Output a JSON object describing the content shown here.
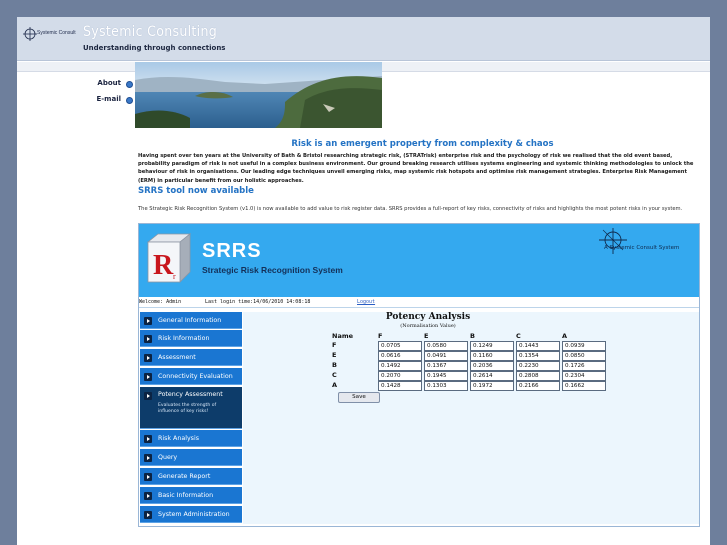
{
  "brand": {
    "logo_text": "Systemic Consult",
    "title": "Systemic Consulting",
    "tagline": "Understanding through connections"
  },
  "nav": [
    {
      "label": "About"
    },
    {
      "label": "E-mail"
    }
  ],
  "headline": "Risk is an emergent property from complexity & chaos",
  "intro": "Having spent over ten years at the University of Bath & Bristol researching strategic risk, (STRATrisk) enterprise risk and the psychology of risk we realised that the old event based, probability paradigm of risk is not useful in a complex business environment. Our ground breaking research utilises systems engineering and systemic thinking methodologies to unlock the behaviour of risk in organisations. Our leading edge techniques unveil emerging risks, map systemic risk hotspots and optimise risk management strategies. Enterprise Risk Management (ERM) in particular benefit from our holistic approaches.",
  "srrs_section": {
    "heading": "SRRS tool now available",
    "text": "The Strategic Risk Recognition System (v1.0) is now available to add value to risk register data. SRRS provides a full-report of key risks, connectivity of risks and highlights the most potent risks in your system."
  },
  "app": {
    "cube_letter": "R",
    "cube_sub": "r",
    "name": "SRRS",
    "full_name": "Strategic Risk Recognition System",
    "consult_label": "A Systemic Consult System",
    "status": {
      "welcome": "Welcome: Admin",
      "last_login": "Last login time:14/06/2010 14:08:18",
      "logout": "Logout"
    },
    "menu": [
      {
        "label": "General Information"
      },
      {
        "label": "Risk Information"
      },
      {
        "label": "Assessment"
      },
      {
        "label": "Connectivity Evaluation"
      },
      {
        "label": "Potency Assessment",
        "desc": "Evaluates the strength of influence of key risks!"
      },
      {
        "label": "Risk Analysis"
      },
      {
        "label": "Query"
      },
      {
        "label": "Generate Report"
      },
      {
        "label": "Basic Information"
      },
      {
        "label": "System Administration"
      }
    ],
    "potency": {
      "title": "Potency Analysis",
      "subtitle": "(Normalisation Value)",
      "name_header": "Name",
      "columns": [
        "F",
        "E",
        "B",
        "C",
        "A"
      ],
      "rows": [
        {
          "name": "F",
          "values": [
            "0.0705",
            "0.0580",
            "0.1249",
            "0.1443",
            "0.0939"
          ]
        },
        {
          "name": "E",
          "values": [
            "0.0616",
            "0.0491",
            "0.1160",
            "0.1354",
            "0.0850"
          ]
        },
        {
          "name": "B",
          "values": [
            "0.1492",
            "0.1367",
            "0.2036",
            "0.2230",
            "0.1726"
          ]
        },
        {
          "name": "C",
          "values": [
            "0.2070",
            "0.1945",
            "0.2614",
            "0.2808",
            "0.2304"
          ]
        },
        {
          "name": "A",
          "values": [
            "0.1428",
            "0.1303",
            "0.1972",
            "0.2166",
            "0.1662"
          ]
        }
      ],
      "save_label": "Save"
    }
  }
}
